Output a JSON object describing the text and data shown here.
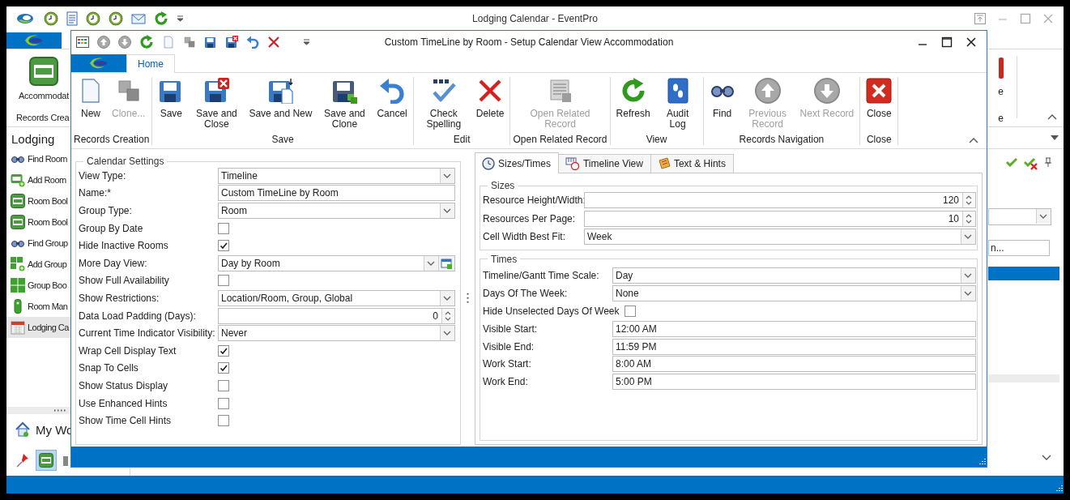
{
  "main_window": {
    "title": "Lodging Calendar - EventPro",
    "ribbon": {
      "button": "Accommodat",
      "group": "Records Crea",
      "cut_texts": [
        "e",
        "e"
      ]
    },
    "sidebar": {
      "title": "Lodging",
      "items": [
        {
          "label": "Find Room",
          "selected": false
        },
        {
          "label": "Add Room",
          "selected": false
        },
        {
          "label": "Room Bool",
          "selected": false
        },
        {
          "label": "Room Bool",
          "selected": false
        },
        {
          "label": "Find Group",
          "selected": false
        },
        {
          "label": "Add Group",
          "selected": false
        },
        {
          "label": "Group Boo",
          "selected": false
        },
        {
          "label": "Room Man",
          "selected": false
        },
        {
          "label": "Lodging Ca",
          "selected": true
        }
      ],
      "footer": "My Wo"
    },
    "side_field": "n..."
  },
  "dialog": {
    "title": "Custom TimeLine by Room - Setup Calendar View Accommodation",
    "tabs": [
      {
        "label": "Home",
        "selected": true
      }
    ],
    "ribbon_groups": [
      {
        "label": "Records Creation",
        "buttons": [
          {
            "label": "New",
            "disabled": false
          },
          {
            "label": "Clone...",
            "disabled": true
          }
        ]
      },
      {
        "label": "Save",
        "buttons": [
          {
            "label": "Save",
            "disabled": false
          },
          {
            "label": "Save and Close",
            "disabled": false
          },
          {
            "label": "Save and New",
            "disabled": false
          },
          {
            "label": "Save and Clone",
            "disabled": false
          },
          {
            "label": "Cancel",
            "disabled": false
          }
        ]
      },
      {
        "label": "Edit",
        "buttons": [
          {
            "label": "Check Spelling",
            "disabled": false
          },
          {
            "label": "Delete",
            "disabled": false
          }
        ]
      },
      {
        "label": "Open Related Record",
        "buttons": [
          {
            "label": "Open Related Record",
            "disabled": true
          }
        ]
      },
      {
        "label": "View",
        "buttons": [
          {
            "label": "Refresh",
            "disabled": false
          },
          {
            "label": "Audit Log",
            "disabled": false
          }
        ]
      },
      {
        "label": "Records Navigation",
        "buttons": [
          {
            "label": "Find",
            "disabled": false
          },
          {
            "label": "Previous Record",
            "disabled": true
          },
          {
            "label": "Next Record",
            "disabled": true
          }
        ]
      },
      {
        "label": "Close",
        "buttons": [
          {
            "label": "Close",
            "disabled": false
          }
        ]
      }
    ],
    "calendar_settings": {
      "title": "Calendar Settings",
      "fields": [
        {
          "label": "View Type:",
          "kind": "combo",
          "value": "Timeline"
        },
        {
          "label": "Name:*",
          "kind": "text",
          "value": "Custom TimeLine by Room"
        },
        {
          "label": "Group Type:",
          "kind": "combo",
          "value": "Room"
        },
        {
          "label": "Group By Date",
          "kind": "check",
          "checked": false
        },
        {
          "label": "Hide Inactive Rooms",
          "kind": "check",
          "checked": true
        },
        {
          "label": "More Day View:",
          "kind": "combo_button",
          "value": "Day by Room"
        },
        {
          "label": "Show Full Availability",
          "kind": "check",
          "checked": false
        },
        {
          "label": "Show Restrictions:",
          "kind": "combo",
          "value": "Location/Room, Group, Global"
        },
        {
          "label": "Data Load Padding (Days):",
          "kind": "spin",
          "value": "0"
        },
        {
          "label": "Current Time Indicator Visibility:",
          "kind": "combo",
          "value": "Never"
        },
        {
          "label": "Wrap Cell Display Text",
          "kind": "check",
          "checked": true
        },
        {
          "label": "Snap To Cells",
          "kind": "check",
          "checked": true
        },
        {
          "label": "Show Status Display",
          "kind": "check",
          "checked": false
        },
        {
          "label": "Use Enhanced Hints",
          "kind": "check",
          "checked": false
        },
        {
          "label": "Show Time Cell Hints",
          "kind": "check",
          "checked": false
        }
      ]
    },
    "detail_tabs": [
      {
        "label": "Sizes/Times",
        "selected": true
      },
      {
        "label": "Timeline View",
        "selected": false
      },
      {
        "label": "Text & Hints",
        "selected": false
      }
    ],
    "detail_groups": [
      {
        "title": "Sizes",
        "fields": [
          {
            "label": "Resource Height/Width:",
            "kind": "spin",
            "value": "120"
          },
          {
            "label": "Resources Per Page:",
            "kind": "spin",
            "value": "10"
          },
          {
            "label": "Cell Width Best Fit:",
            "kind": "combo",
            "value": "Week"
          }
        ]
      },
      {
        "title": "Times",
        "fields": [
          {
            "label": "Timeline/Gantt Time Scale:",
            "kind": "combo",
            "value": "Day"
          },
          {
            "label": "Days Of The Week:",
            "kind": "combo",
            "value": "None"
          },
          {
            "label": "Hide Unselected Days Of Week",
            "kind": "check",
            "checked": false
          },
          {
            "label": "Visible Start:",
            "kind": "text",
            "value": "12:00 AM"
          },
          {
            "label": "Visible End:",
            "kind": "text",
            "value": "11:59 PM"
          },
          {
            "label": "Work Start:",
            "kind": "text",
            "value": "8:00 AM"
          },
          {
            "label": "Work End:",
            "kind": "text",
            "value": "5:00 PM"
          }
        ]
      }
    ]
  }
}
